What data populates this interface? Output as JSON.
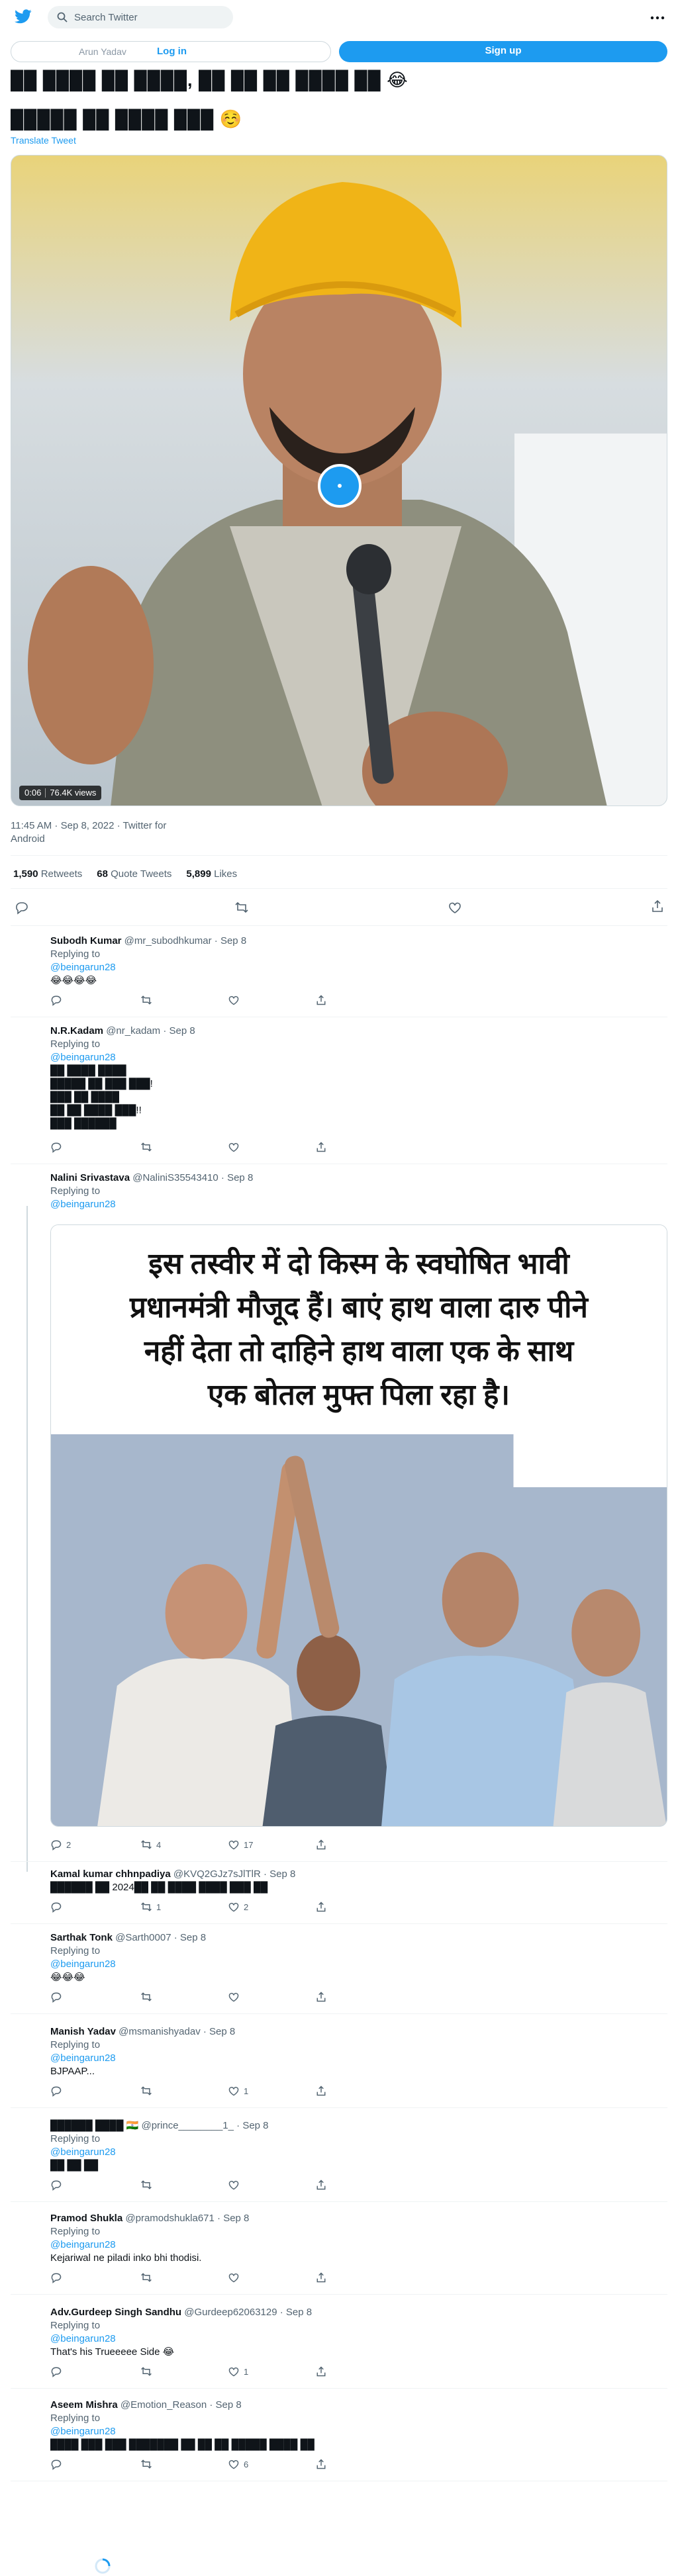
{
  "header": {
    "search_placeholder": "Search Twitter",
    "brand_color": "#1d9bf0"
  },
  "auth": {
    "login_prefill": "Arun Yadav",
    "login_label": "Log in",
    "signup_label": "Sign up"
  },
  "tweet": {
    "line1": "██ ████ ██ ████, ██ ██ ██ ████ ██ 😂",
    "line2": "█████ ██ ████ ███ ☺️",
    "translate_label": "Translate Tweet",
    "video_time": "0:06",
    "video_views": "76.4K views",
    "timestamp": "11:45 AM · Sep 8, 2022 · Twitter for Android",
    "retweets_count": "1,590",
    "retweets_label": "Retweets",
    "quotes_count": "68",
    "quotes_label": "Quote Tweets",
    "likes_count": "5,899",
    "likes_label": "Likes"
  },
  "replies": [
    {
      "name": "Subodh Kumar",
      "handle": "@mr_subodhkumar",
      "date": "· Sep 8",
      "replying": "Replying to",
      "mention": "@beingarun28",
      "text": "😂😂😂😂",
      "counts": [
        "",
        "",
        ""
      ]
    },
    {
      "name": "N.R.Kadam",
      "handle": "@nr_kadam",
      "date": "· Sep 8",
      "replying": "Replying to",
      "mention": "@beingarun28",
      "text": "██ ████ ████\n█████ ██ ███ ███!\n███ ██ ████\n██ ██ ████ ███!!\n███ ██████",
      "counts": [
        "",
        "",
        ""
      ]
    },
    {
      "name": "Nalini Srivastava",
      "handle": "@NaliniS35543410",
      "date": "· Sep 8",
      "replying": "Replying to",
      "mention": "@beingarun28",
      "text": "",
      "counts": [
        "2",
        "4",
        "17"
      ],
      "image_caption": [
        "इस तस्वीर में दो किस्म के स्वघोषित भावी",
        "प्रधानमंत्री मौजूद हैं। बाएं हाथ वाला दारु पीने",
        "नहीं देता तो दाहिने हाथ वाला एक के साथ",
        "एक बोतल मुफ्त पिला रहा है।"
      ]
    },
    {
      "name": "Kamal kumar chhnpadiya",
      "handle": "@KVQ2GJz7sJlTlR",
      "date": "· Sep 8",
      "replying": "",
      "mention": "",
      "text": "██████ ██ 2024██ ██ ████ ████ ███ ██",
      "counts": [
        "",
        "1",
        "2"
      ]
    },
    {
      "name": "Sarthak Tonk",
      "handle": "@Sarth0007",
      "date": "· Sep 8",
      "replying": "Replying to",
      "mention": "@beingarun28",
      "text": "😂😂😂",
      "counts": [
        "",
        "",
        ""
      ]
    },
    {
      "name": "Manish Yadav",
      "handle": "@msmanishyadav",
      "date": "· Sep 8",
      "replying": "Replying to",
      "mention": "@beingarun28",
      "text": "BJPAAP...",
      "counts": [
        "",
        "",
        "1"
      ]
    },
    {
      "name": "██████ ████ 🇮🇳",
      "handle": "@prince________1_",
      "date": "· Sep 8",
      "replying": "Replying to",
      "mention": "@beingarun28",
      "text": "██ ██ ██",
      "counts": [
        "",
        "",
        ""
      ]
    },
    {
      "name": "Pramod Shukla",
      "handle": "@pramodshukla671",
      "date": "· Sep 8",
      "replying": "Replying to",
      "mention": "@beingarun28",
      "text": "Kejariwal ne piladi inko bhi thodisi.",
      "counts": [
        "",
        "",
        ""
      ]
    },
    {
      "name": "Adv.Gurdeep Singh Sandhu",
      "handle": "@Gurdeep62063129",
      "date": "· Sep 8",
      "replying": "Replying to",
      "mention": "@beingarun28",
      "text": "That's his Trueeeee Side 😂",
      "counts": [
        "",
        "",
        "1"
      ]
    },
    {
      "name": "Aseem Mishra",
      "handle": "@Emotion_Reason",
      "date": "· Sep 8",
      "replying": "Replying to",
      "mention": "@beingarun28",
      "text": "████ ███ ███ ███████ ██ ██ ██ █████ ████ ██",
      "counts": [
        "",
        "",
        "6"
      ]
    }
  ]
}
